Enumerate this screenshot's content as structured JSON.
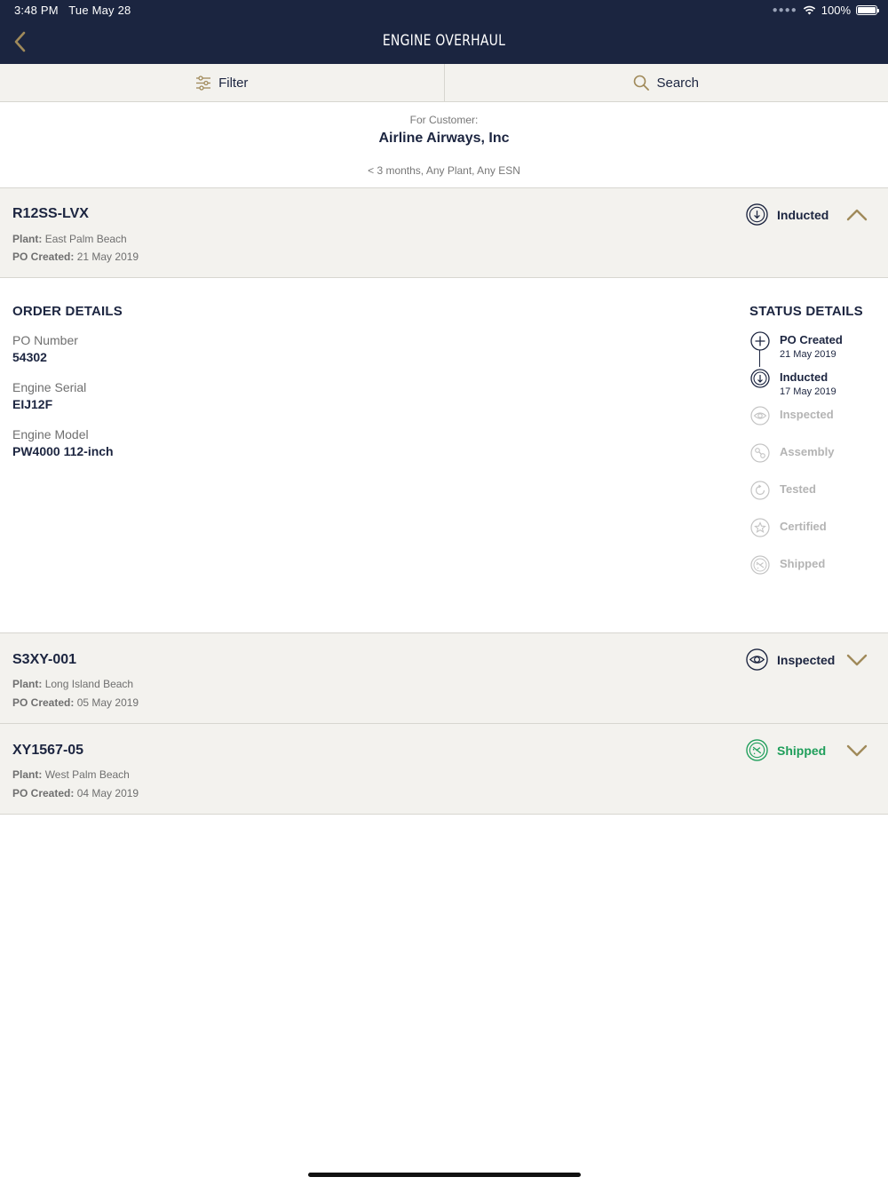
{
  "status_bar": {
    "time": "3:48 PM",
    "date": "Tue May 28",
    "battery": "100%",
    "battery_level": 1.0
  },
  "nav": {
    "title": "ENGINE OVERHAUL",
    "back_icon": "chevron-left-icon"
  },
  "toolbar": {
    "filter_label": "Filter",
    "search_label": "Search"
  },
  "customer": {
    "caption": "For Customer:",
    "name": "Airline Airways, Inc",
    "filters": "< 3 months, Any Plant, Any ESN"
  },
  "labels": {
    "plant": "Plant:",
    "po_created": "PO Created:"
  },
  "orders": [
    {
      "id": "R12SS-LVX",
      "plant": "East Palm Beach",
      "po_created": "21 May 2019",
      "status": "Inducted",
      "status_icon": "inducted-icon",
      "expanded": true
    },
    {
      "id": "S3XY-001",
      "plant": "Long Island Beach",
      "po_created": "05 May 2019",
      "status": "Inspected",
      "status_icon": "eye-icon",
      "expanded": false
    },
    {
      "id": "XY1567-05",
      "plant": "West Palm Beach",
      "po_created": "04 May 2019",
      "status": "Shipped",
      "status_icon": "plane-icon",
      "status_color": "#1e9e5a",
      "expanded": false
    }
  ],
  "order_details": {
    "title": "ORDER DETAILS",
    "fields": [
      {
        "label": "PO Number",
        "value": "54302"
      },
      {
        "label": "Engine Serial",
        "value": "EIJ12F"
      },
      {
        "label": "Engine Model",
        "value": "PW4000 112-inch"
      }
    ]
  },
  "status_details": {
    "title": "STATUS DETAILS",
    "steps": [
      {
        "name": "PO Created",
        "date": "21 May 2019",
        "state": "done",
        "icon": "plus-icon"
      },
      {
        "name": "Inducted",
        "date": "17 May 2019",
        "state": "done",
        "icon": "inducted-icon"
      },
      {
        "name": "Inspected",
        "date": "",
        "state": "pending",
        "icon": "eye-icon"
      },
      {
        "name": "Assembly",
        "date": "",
        "state": "pending",
        "icon": "wrench-icon"
      },
      {
        "name": "Tested",
        "date": "",
        "state": "pending",
        "icon": "refresh-icon"
      },
      {
        "name": "Certified",
        "date": "",
        "state": "pending",
        "icon": "star-icon"
      },
      {
        "name": "Shipped",
        "date": "",
        "state": "pending",
        "icon": "plane-icon"
      }
    ]
  },
  "colors": {
    "navy": "#1b2540",
    "gold": "#a08a5a",
    "shipped_green": "#1e9e5a",
    "pending_gray": "#b4b4b4",
    "row_bg": "#f3f2ee"
  }
}
